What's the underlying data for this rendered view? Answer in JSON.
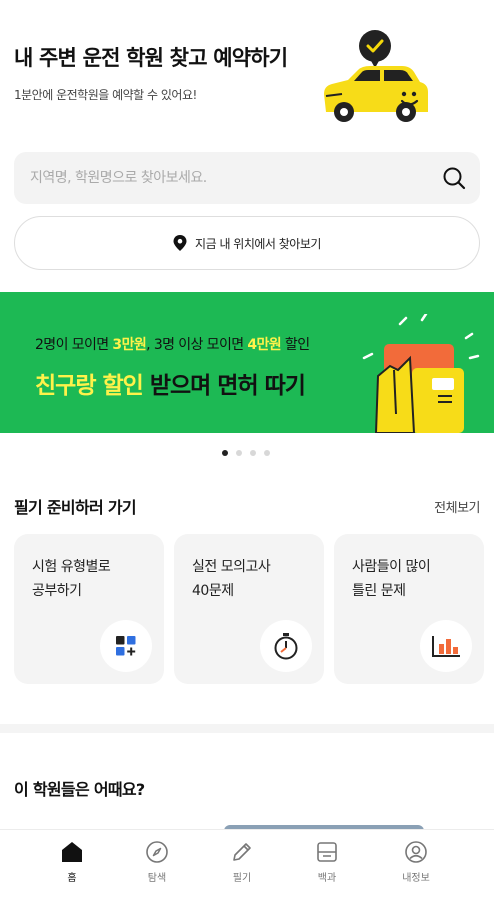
{
  "header": {
    "title": "내 주변 운전 학원 찾고 예약하기",
    "subtitle": "1분안에 운전학원을 예약할 수 있어요!"
  },
  "search": {
    "placeholder": "지역명, 학원명으로 찾아보세요.",
    "value": ""
  },
  "location_button": {
    "label": "지금 내 위치에서 찾아보기"
  },
  "banner": {
    "line1_a": "2명이 모이면 ",
    "line1_b": "3만원",
    "line1_c": ", 3명 이상 모이면 ",
    "line1_d": "4만원",
    "line1_e": " 할인",
    "line2_a": "친구랑 할인",
    "line2_b": " 받으며 면허 따기",
    "colors": {
      "background": "#1db954",
      "highlight": "#fff24a"
    }
  },
  "carousel": {
    "pages": 4,
    "active_index": 0
  },
  "written_section": {
    "title": "필기 준비하러 가기",
    "more": "전체보기",
    "cards": [
      {
        "line1": "시험 유형별로",
        "line2": "공부하기",
        "icon": "grid-plus-icon"
      },
      {
        "line1": "실전 모의고사",
        "line2": "40문제",
        "icon": "stopwatch-icon"
      },
      {
        "line1": "사람들이 많이",
        "line2": "틀린 문제",
        "icon": "bar-chart-icon"
      }
    ]
  },
  "academy_section": {
    "title": "이 학원들은 어때요?"
  },
  "tabbar": {
    "tabs": [
      {
        "label": "홈",
        "icon": "home-icon",
        "active": true
      },
      {
        "label": "탐색",
        "icon": "compass-icon",
        "active": false
      },
      {
        "label": "필기",
        "icon": "pencil-icon",
        "active": false
      },
      {
        "label": "백과",
        "icon": "book-icon",
        "active": false
      },
      {
        "label": "내정보",
        "icon": "profile-icon",
        "active": false
      }
    ]
  }
}
